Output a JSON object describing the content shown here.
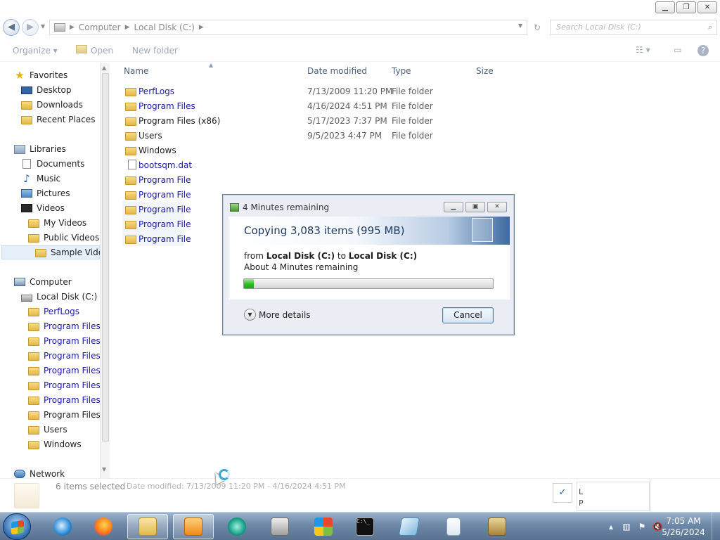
{
  "window": {
    "minimize": "▁",
    "restore": "❐",
    "close": "✕"
  },
  "address": {
    "back": "◀",
    "forward": "▶",
    "crumbs": [
      "Computer",
      "Local Disk (C:)"
    ],
    "search_placeholder": "Search Local Disk (C:)"
  },
  "toolbar": {
    "organize": "Organize ▾",
    "open": "Open",
    "new_folder": "New folder"
  },
  "nav": {
    "favorites": "Favorites",
    "desktop": "Desktop",
    "downloads": "Downloads",
    "recent_places": "Recent Places",
    "libraries": "Libraries",
    "documents": "Documents",
    "music": "Music",
    "pictures": "Pictures",
    "videos": "Videos",
    "my_videos": "My Videos",
    "public_videos": "Public Videos",
    "sample_videos": "Sample Vide",
    "computer": "Computer",
    "local_disk": "Local Disk (C:)",
    "drive_folders": [
      "PerfLogs",
      "Program Files",
      "Program Files -",
      "Program Files -",
      "Program Files -",
      "Program Files -",
      "Program Files -",
      "Program Files (",
      "Users",
      "Windows"
    ],
    "network": "Network"
  },
  "columns": {
    "name": "Name",
    "date_modified": "Date modified",
    "type": "Type",
    "size": "Size"
  },
  "files": [
    {
      "name": "PerfLogs",
      "date": "7/13/2009 11:20 PM",
      "type": "File folder"
    },
    {
      "name": "Program Files",
      "date": "4/16/2024 4:51 PM",
      "type": "File folder"
    },
    {
      "name": "Program Files (x86)",
      "date": "5/17/2023 7:37 PM",
      "type": "File folder"
    },
    {
      "name": "Users",
      "date": "9/5/2023 4:47 PM",
      "type": "File folder"
    },
    {
      "name": "Windows",
      "date": "",
      "type": ""
    },
    {
      "name": "bootsqm.dat",
      "date": "",
      "type": ""
    },
    {
      "name": "Program File",
      "date": "",
      "type": ""
    },
    {
      "name": "Program File",
      "date": "",
      "type": ""
    },
    {
      "name": "Program File",
      "date": "",
      "type": ""
    },
    {
      "name": "Program File",
      "date": "",
      "type": ""
    },
    {
      "name": "Program File",
      "date": "",
      "type": ""
    }
  ],
  "dialog": {
    "title": "4 Minutes remaining",
    "heading": "Copying 3,083 items (995 MB)",
    "from_prefix": "from ",
    "source": "Local Disk (C:)",
    "to_word": " to ",
    "destination": "Local Disk (C:)",
    "remaining": "About 4 Minutes remaining",
    "progress_percent": 4,
    "more_details": "More details",
    "cancel": "Cancel"
  },
  "details": {
    "selected": "6 items selected",
    "date_modified": "Date modified: 7/13/2009 11:20 PM - 4/16/2024 4:51 PM",
    "popup_lines": [
      "L",
      "P"
    ]
  },
  "taskbar": {
    "time": "7:05 AM",
    "date": "5/26/2024"
  }
}
